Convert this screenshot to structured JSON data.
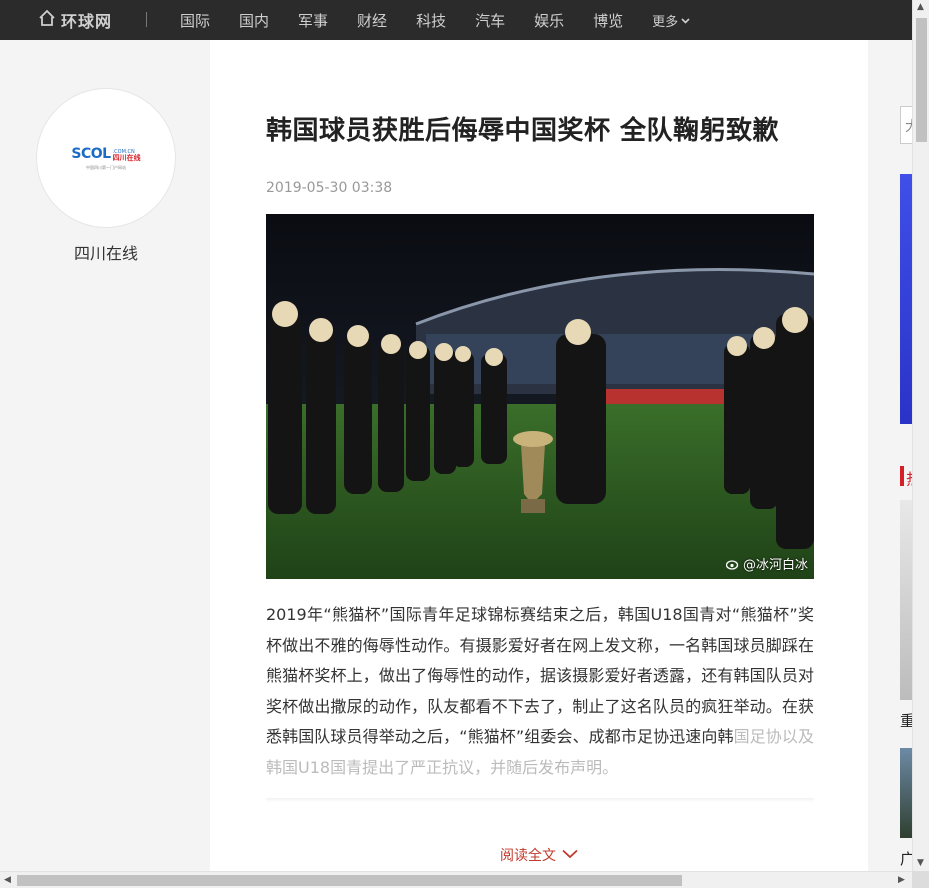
{
  "nav": {
    "logo_text": "环球网",
    "logo_icon": "home-icon",
    "items": [
      "国际",
      "国内",
      "军事",
      "财经",
      "科技",
      "汽车",
      "娱乐",
      "博览"
    ],
    "more_label": "更多"
  },
  "source": {
    "logo_main": "SCOL",
    "logo_domain": ".COM.CN",
    "logo_cn": "四川在线",
    "logo_tagline": "中国四川第一门户网站",
    "name": "四川在线"
  },
  "article": {
    "title": "韩国球员获胜后侮辱中国奖杯 全队鞠躬致歉",
    "date": "2019-05-30 03:38",
    "image_watermark": "@冰河白冰",
    "paragraph_main": "2019年“熊猫杯”国际青年足球锦标赛结束之后，韩国U18国青对“熊猫杯”奖杯做出不雅的侮辱性动作。有摄影爱好者在网上发文称，一名韩国球员脚踩在熊猫杯奖杯上，做出了侮辱性的动作，据该摄影爱好者透露，还有韩国队员对奖杯做出撒尿的动作，队友都看不下去了，制止了这名队员的疯狂举动。在获悉韩国队球员得举动之后，“熊猫杯”组委会、成都市足协迅速向韩",
    "paragraph_faded": "国足协以及韩国U18国青提出了严正抗议，并随后发布声明。",
    "read_full_label": "阅读全文"
  },
  "right_panel": {
    "search_stub": "大",
    "section_char": "热",
    "item1_char": "重",
    "item2_char": "广"
  },
  "colors": {
    "nav_bg": "#2b2b2b",
    "accent_red": "#c0392b",
    "page_bg": "#f4f4f4"
  }
}
